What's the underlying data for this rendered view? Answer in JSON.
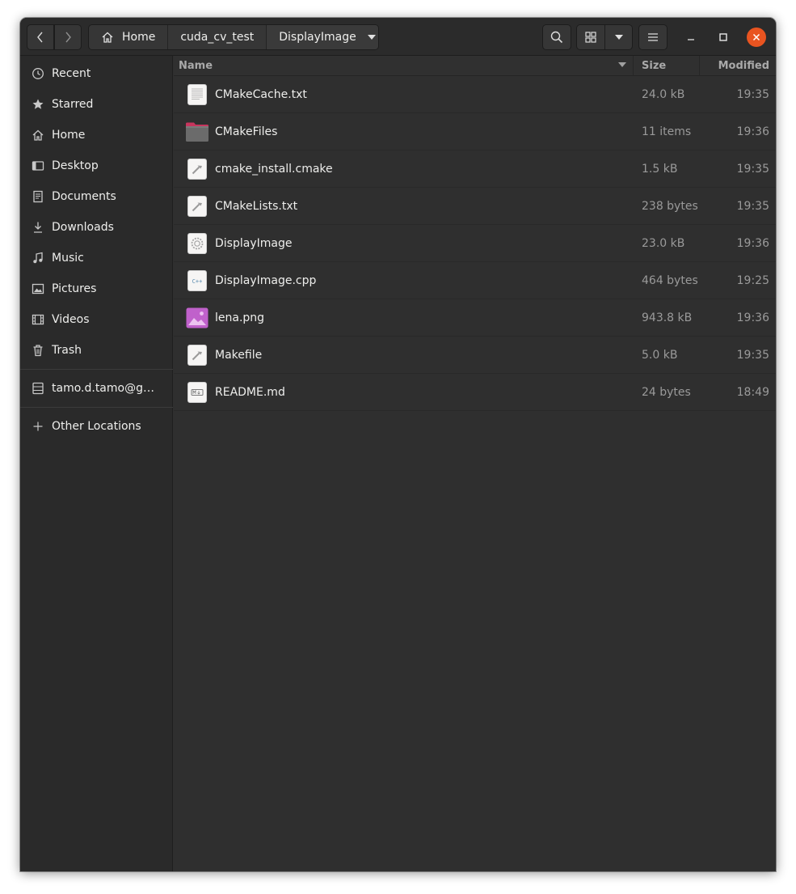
{
  "headerbar": {
    "breadcrumbs": [
      "Home",
      "cuda_cv_test",
      "DisplayImage"
    ]
  },
  "sidebar": {
    "items": [
      {
        "label": "Recent",
        "icon": "clock-icon"
      },
      {
        "label": "Starred",
        "icon": "star-icon"
      },
      {
        "label": "Home",
        "icon": "home-icon"
      },
      {
        "label": "Desktop",
        "icon": "desktop-icon"
      },
      {
        "label": "Documents",
        "icon": "documents-icon"
      },
      {
        "label": "Downloads",
        "icon": "download-icon"
      },
      {
        "label": "Music",
        "icon": "music-icon"
      },
      {
        "label": "Pictures",
        "icon": "pictures-icon"
      },
      {
        "label": "Videos",
        "icon": "videos-icon"
      },
      {
        "label": "Trash",
        "icon": "trash-icon"
      }
    ],
    "network_drive": {
      "label": "tamo.d.tamo@g…",
      "icon": "network-drive-icon"
    },
    "other_locations": {
      "label": "Other Locations",
      "icon": "plus-icon"
    }
  },
  "list": {
    "columns": {
      "name": "Name",
      "size": "Size",
      "modified": "Modified"
    },
    "files": [
      {
        "name": "CMakeCache.txt",
        "size": "24.0 kB",
        "modified": "19:35",
        "icon": "text-file-icon"
      },
      {
        "name": "CMakeFiles",
        "size": "11 items",
        "modified": "19:36",
        "icon": "folder-icon"
      },
      {
        "name": "cmake_install.cmake",
        "size": "1.5 kB",
        "modified": "19:35",
        "icon": "script-file-icon"
      },
      {
        "name": "CMakeLists.txt",
        "size": "238 bytes",
        "modified": "19:35",
        "icon": "script-file-icon"
      },
      {
        "name": "DisplayImage",
        "size": "23.0 kB",
        "modified": "19:36",
        "icon": "executable-file-icon"
      },
      {
        "name": "DisplayImage.cpp",
        "size": "464 bytes",
        "modified": "19:25",
        "icon": "cpp-file-icon"
      },
      {
        "name": "lena.png",
        "size": "943.8 kB",
        "modified": "19:36",
        "icon": "image-file-icon"
      },
      {
        "name": "Makefile",
        "size": "5.0 kB",
        "modified": "19:35",
        "icon": "script-file-icon"
      },
      {
        "name": "README.md",
        "size": "24 bytes",
        "modified": "18:49",
        "icon": "markdown-file-icon"
      }
    ]
  },
  "colors": {
    "window_bg": "#2f2f2f",
    "sidebar_bg": "#2a2a2a",
    "close_button": "#e95420",
    "image_icon": "#c061cb",
    "folder": "#6b6b6b"
  }
}
